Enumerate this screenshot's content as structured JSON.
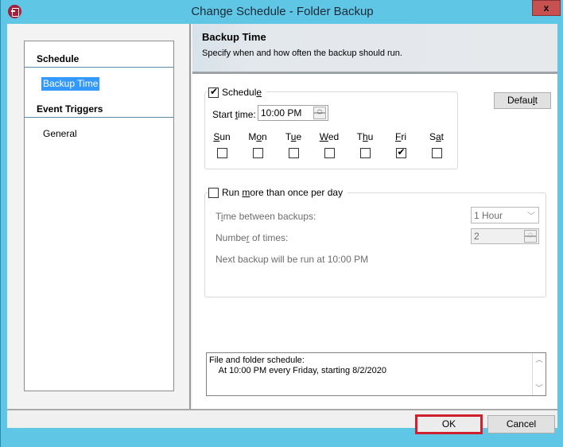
{
  "window": {
    "title": "Change Schedule - Folder Backup",
    "close_label": "x",
    "icon": "app-icon"
  },
  "sidebar": {
    "sections": [
      {
        "label": "Schedule",
        "items": [
          {
            "label": "Backup Time",
            "selected": true
          }
        ]
      },
      {
        "label": "Event Triggers",
        "items": [
          {
            "label": "General",
            "selected": false
          }
        ]
      }
    ]
  },
  "header": {
    "title": "Backup Time",
    "subtitle": "Specify when and how often the backup should run."
  },
  "schedule": {
    "checkbox_label_pre": "Schedul",
    "checkbox_label_u": "e",
    "checked": true,
    "start_time_label_pre": "Start ",
    "start_time_label_u": "t",
    "start_time_label_post": "ime:",
    "start_time_value": "10:00 PM",
    "days": [
      {
        "pre": "",
        "u": "S",
        "post": "un",
        "checked": false
      },
      {
        "pre": "M",
        "u": "o",
        "post": "n",
        "checked": false
      },
      {
        "pre": "T",
        "u": "u",
        "post": "e",
        "checked": false
      },
      {
        "pre": "",
        "u": "W",
        "post": "ed",
        "checked": false
      },
      {
        "pre": "T",
        "u": "h",
        "post": "u",
        "checked": false
      },
      {
        "pre": "",
        "u": "F",
        "post": "ri",
        "checked": true
      },
      {
        "pre": "S",
        "u": "a",
        "post": "t",
        "checked": false
      }
    ]
  },
  "default_button": {
    "pre": "Defau",
    "u": "l",
    "post": "t"
  },
  "multi_run": {
    "checkbox_label_pre": "Run ",
    "checkbox_label_u": "m",
    "checkbox_label_post": "ore than once per day",
    "checked": false,
    "time_between_pre": "T",
    "time_between_u": "i",
    "time_between_post": "me between backups:",
    "time_between_value": "1 Hour",
    "number_pre": "Numbe",
    "number_u": "r",
    "number_post": " of times:",
    "number_value": "2",
    "next_backup_text": "Next backup will be run at 10:00 PM"
  },
  "summary": {
    "text": "File and folder schedule:\n    At 10:00 PM every Friday, starting 8/2/2020"
  },
  "footer": {
    "ok_label": "OK",
    "cancel_label": "Cancel",
    "highlight_color": "#d0202e"
  },
  "colors": {
    "frame": "#5fc6e6",
    "selection": "#3399ff",
    "close": "#c75050"
  }
}
